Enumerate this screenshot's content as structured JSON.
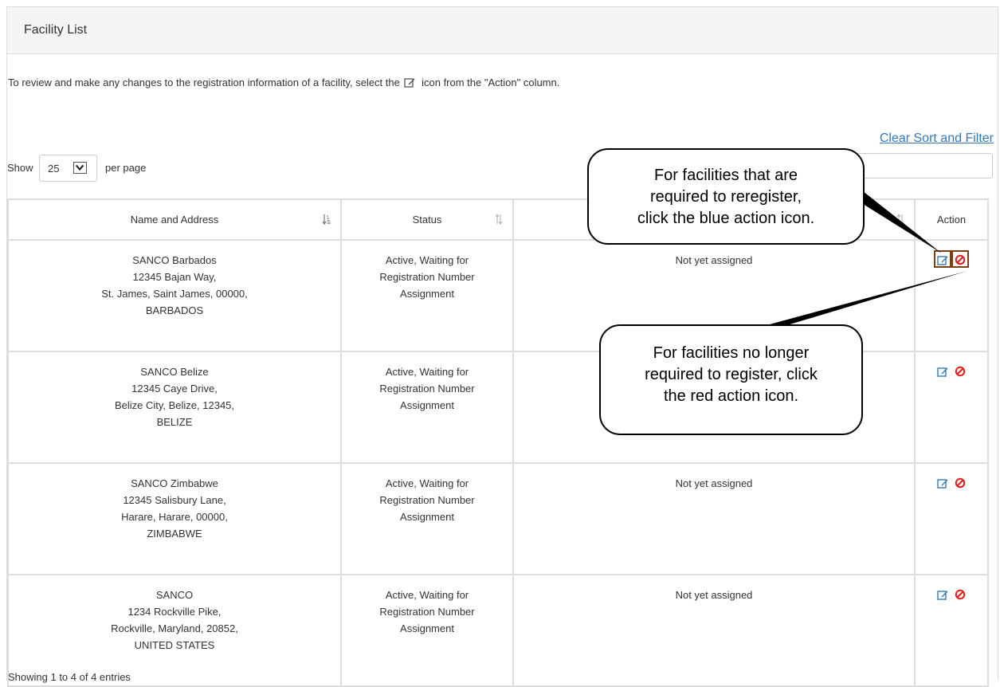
{
  "panel": {
    "title": "Facility List"
  },
  "instructions": {
    "before_icon": "To review and make any changes to the registration information of a facility, select the",
    "after_icon": "icon from the \"Action\" column."
  },
  "toolbar": {
    "clear_label": "Clear Sort and Filter",
    "show_label": "Show",
    "page_size": "25",
    "per_page_label": "per page",
    "filter_placeholder": ""
  },
  "table": {
    "columns": [
      {
        "label": "Name and Address",
        "sort": "sorted-asc"
      },
      {
        "label": "Status",
        "sort": "sortable"
      },
      {
        "label": "",
        "sort": "sortable"
      },
      {
        "label": "Action",
        "sort": "none"
      }
    ],
    "rows": [
      {
        "name": [
          "SANCO Barbados",
          "12345 Bajan Way,",
          "St. James, Saint James, 00000,",
          "BARBADOS"
        ],
        "status": [
          "Active, Waiting for",
          "Registration Number",
          "Assignment"
        ],
        "registration": "Not yet assigned"
      },
      {
        "name": [
          "SANCO Belize",
          "12345 Caye Drive,",
          "Belize City, Belize, 12345,",
          "BELIZE"
        ],
        "status": [
          "Active, Waiting for",
          "Registration Number",
          "Assignment"
        ],
        "registration": ""
      },
      {
        "name": [
          "SANCO Zimbabwe",
          "12345 Salisbury Lane,",
          "Harare, Harare, 00000,",
          "ZIMBABWE"
        ],
        "status": [
          "Active, Waiting for",
          "Registration Number",
          "Assignment"
        ],
        "registration": "Not yet assigned"
      },
      {
        "name": [
          "SANCO",
          "1234 Rockville Pike,",
          "Rockville, Maryland, 20852,",
          "UNITED STATES"
        ],
        "status": [
          "Active, Waiting for",
          "Registration Number",
          "Assignment"
        ],
        "registration": "Not yet assigned"
      }
    ]
  },
  "footer": {
    "summary": "Showing 1 to 4 of 4 entries"
  },
  "callouts": {
    "reregister": [
      "For facilities that are",
      "required to reregister,",
      "click the blue action icon."
    ],
    "deregister": [
      "For facilities no longer",
      "required to register, click",
      "the red action icon."
    ]
  },
  "icons": {
    "edit": "edit-square-icon",
    "remove": "no-entry-icon",
    "sort": "sort-icon"
  },
  "colors": {
    "edit_icon": "#337ab7",
    "remove_icon": "#e41a1a",
    "link": "#337ab7",
    "highlight_box": "#7b3f10"
  }
}
